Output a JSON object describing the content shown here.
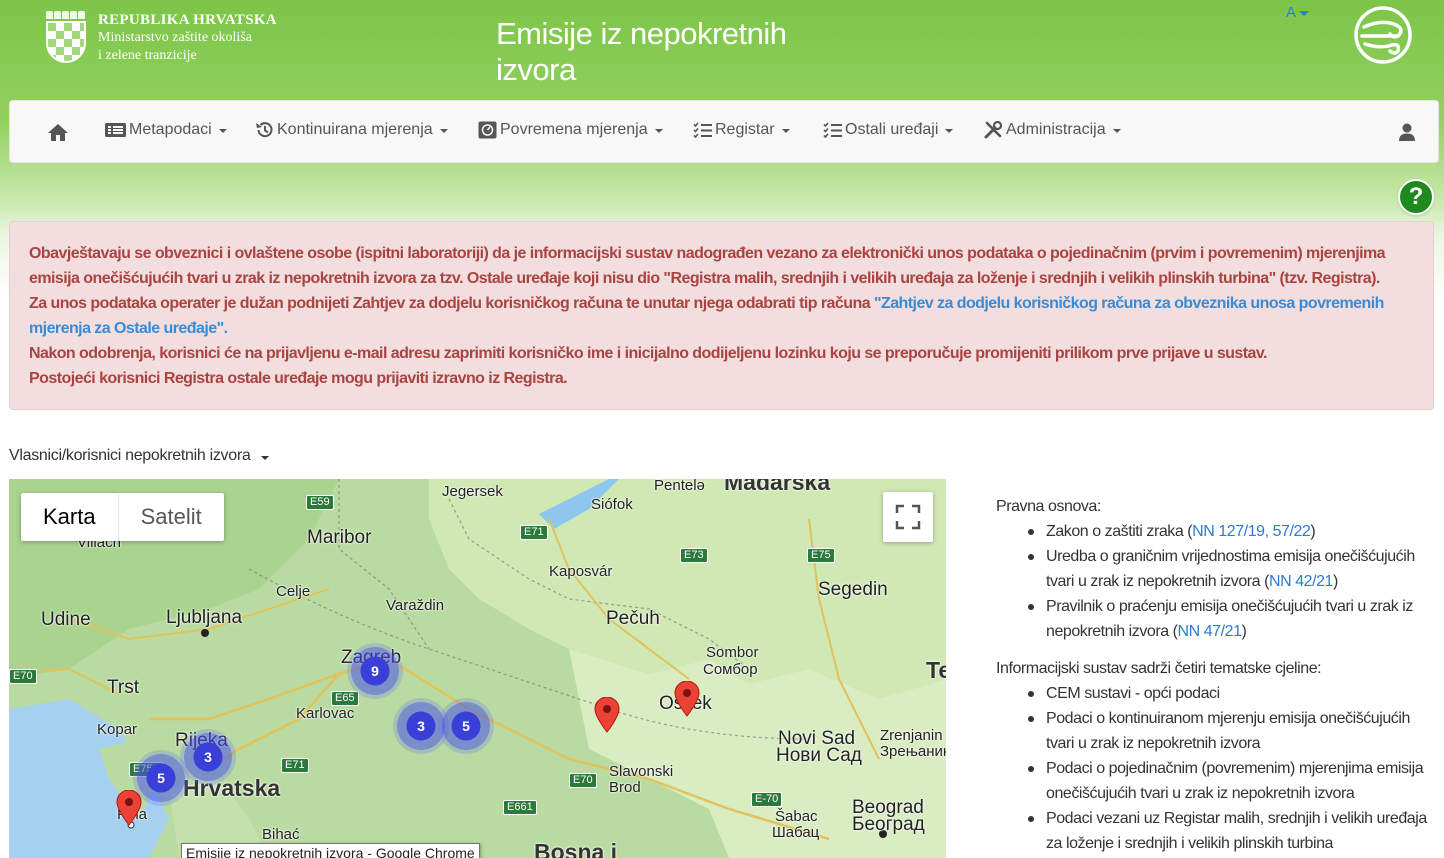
{
  "header": {
    "org_line1": "REPUBLIKA HRVATSKA",
    "org_line2": "Ministarstvo zaštite okoliša",
    "org_line3": "i zelene tranzicije",
    "app_title": "Emisije iz nepokretnih izvora",
    "language": "A"
  },
  "nav": {
    "items": [
      {
        "label": "Metapodaci",
        "icon": "list-icon"
      },
      {
        "label": "Kontinuirana mjerenja",
        "icon": "history-icon"
      },
      {
        "label": "Povremena mjerenja",
        "icon": "gauge-icon"
      },
      {
        "label": "Registar",
        "icon": "checklist-icon"
      },
      {
        "label": "Ostali uređaji",
        "icon": "checklist-icon"
      },
      {
        "label": "Administracija",
        "icon": "tools-icon"
      }
    ]
  },
  "help": {
    "label": "?"
  },
  "alert": {
    "p1": "Obavještavaju se obveznici i ovlaštene osobe (ispitni laboratoriji) da je informacijski sustav nadograđen vezano za elektronički unos podataka o pojedinačnim (prvim i povremenim) mjerenjima emisija onečišćujućih tvari u zrak iz nepokretnih izvora za tzv. Ostale uređaje koji nisu dio \"Registra malih, srednjih i velikih uređaja za loženje i srednjih i velikih plinskih turbina\" (tzv. Registra).",
    "p2_text": "Za unos podataka operater je dužan podnijeti Zahtjev za dodjelu korisničkog računa te unutar njega odabrati tip računa ",
    "p2_link": "\"Zahtjev za dodjelu korisničkog računa za obveznika unosa povremenih mjerenja za Ostale uređaje\".",
    "p3": "Nakon odobrenja, korisnici će na prijavljenu e-mail adresu zaprimiti korisničko ime i inicijalno dodijeljenu lozinku koju se preporučuje promijeniti prilikom prve prijave u sustav.",
    "p4": "Postojeći korisnici Registra ostale uređaje mogu prijaviti izravno iz Registra."
  },
  "owners_dropdown": "Vlasnici/korisnici nepokretnih izvora",
  "map": {
    "type_buttons": [
      "Karta",
      "Satelit"
    ],
    "tooltip": "Emisije iz nepokretnih izvora - Google Chrome",
    "labels": {
      "madarska": "Mađarska",
      "jegersek": "Jegersek",
      "pentele": "Pentelə",
      "siofok": "Siófok",
      "villach": "Villach",
      "maribor": "Maribor",
      "kaposvar": "Kaposvár",
      "celje": "Celje",
      "segedin": "Segedin",
      "ljubljana": "Ljubljana",
      "varazdin": "Varaždin",
      "udine": "Udine",
      "pecuh": "Pečuh",
      "zagreb": "Zagreb",
      "sombor": "Sombor",
      "sombor_cyr": "Сомбор",
      "te": "Te",
      "trst": "Trst",
      "karlovac": "Karlovac",
      "osijek": "Osijek",
      "koper": "Kopar",
      "rijeka": "Rijeka",
      "novi_sad": "Novi Sad",
      "novi_sad_cyr": "Нови Сад",
      "zrenjanin": "Zrenjanin",
      "zrenjanin_cyr": "Зрењанин",
      "slavonski_brod": "Slavonski",
      "slavonski_brod2": "Brod",
      "hrvatska": "Hrvatska",
      "pula": "Pula",
      "beograd": "Beograd",
      "beograd_cyr": "Београд",
      "sabac": "Šabac",
      "sabac_cyr": "Шабац",
      "bihac": "Bihać",
      "bosna": "Bosna i"
    },
    "roads": [
      "E59",
      "E71",
      "E73",
      "E75",
      "E70",
      "E65",
      "E751",
      "E71",
      "E70",
      "E661",
      "E-70"
    ],
    "clusters": [
      {
        "label": "9"
      },
      {
        "label": "3"
      },
      {
        "label": "5"
      },
      {
        "label": "3"
      },
      {
        "label": "5"
      }
    ]
  },
  "info": {
    "legal_title": "Pravna osnova:",
    "legal": [
      {
        "text": "Zakon o zaštiti zraka (",
        "link": "NN 127/19, 57/22",
        "end": ")"
      },
      {
        "text": "Uredba o graničnim vrijednostima emisija onečišćujućih tvari u zrak iz nepokretnih izvora (",
        "link": "NN 42/21",
        "end": ")"
      },
      {
        "text": "Pravilnik o praćenju emisija onečišćujućih tvari u zrak iz nepokretnih izvora (",
        "link": "NN 47/21",
        "end": ")"
      }
    ],
    "system_title": "Informacijski sustav sadrži četiri tematske cjeline:",
    "system": [
      "CEM sustavi - opći podaci",
      "Podaci o kontinuiranom mjerenju emisija onečišćujućih tvari u zrak iz nepokretnih izvora",
      "Podaci o pojedinačnim (povremenim) mjerenjima emisija onečišćujućih tvari u zrak iz nepokretnih izvora",
      "Podaci vezani uz Registar malih, srednjih i velikih uređaja za loženje i srednjih i velikih plinskih turbina"
    ]
  },
  "colors": {
    "header_green": "#7cc548",
    "alert_bg": "#f2dede",
    "alert_text": "#a94442",
    "link": "#2c7ad6",
    "help_green": "#1e8a1e"
  }
}
